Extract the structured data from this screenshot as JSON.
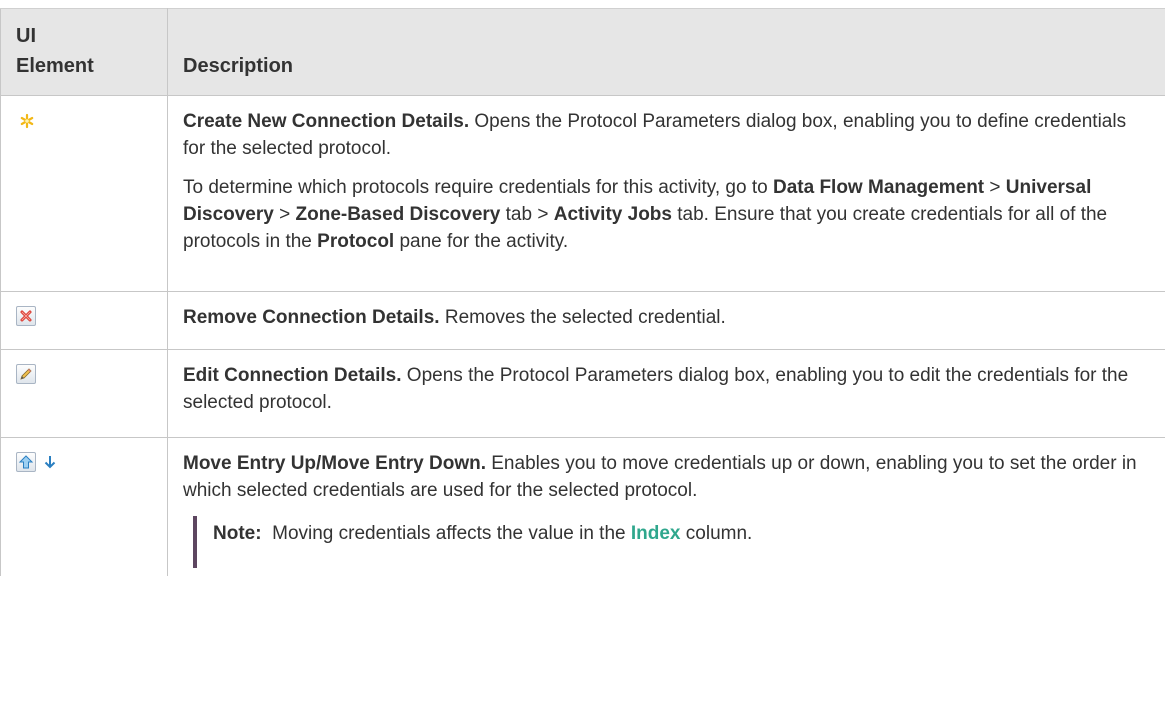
{
  "table": {
    "header": {
      "col1_line1": "UI",
      "col1_line2": "Element",
      "col2": "Description"
    },
    "rows": [
      {
        "icons": [
          "new-asterisk-icon"
        ],
        "title": "Create New Connection Details.",
        "text": " Opens the Protocol Parameters dialog box, enabling you to define credentials for the selected protocol.",
        "extra": {
          "p1": "To determine which protocols require credentials for this activity, go to ",
          "b1": "Data Flow Management",
          "s1": " > ",
          "b2": "Universal Discovery",
          "s2": " > ",
          "b3": "Zone-Based Discovery",
          "s3": " tab > ",
          "b4": "Activity Jobs",
          "s4": " tab. Ensure that you create credentials for all of the protocols in the ",
          "b5": "Protocol",
          "s5": " pane for the activity."
        }
      },
      {
        "icons": [
          "delete-x-icon"
        ],
        "title": "Remove Connection Details.",
        "text": " Removes the selected credential."
      },
      {
        "icons": [
          "pencil-edit-icon"
        ],
        "title": "Edit Connection Details.",
        "text": " Opens the Protocol Parameters dialog box, enabling you to edit the credentials for the selected protocol."
      },
      {
        "icons": [
          "move-up-icon",
          "move-down-icon"
        ],
        "title": "Move Entry Up/Move Entry Down.",
        "text": " Enables you to move credentials up or down, enabling you to set the order in which selected credentials are used for the selected protocol.",
        "note": {
          "label": "Note:",
          "pre": "  Moving credentials affects the value in the ",
          "link": "Index",
          "post": " column."
        }
      }
    ]
  },
  "colors": {
    "header_bg": "#e6e6e6",
    "border": "#c7c7c7",
    "note_bar": "#5d4660",
    "link": "#2fa78d"
  }
}
